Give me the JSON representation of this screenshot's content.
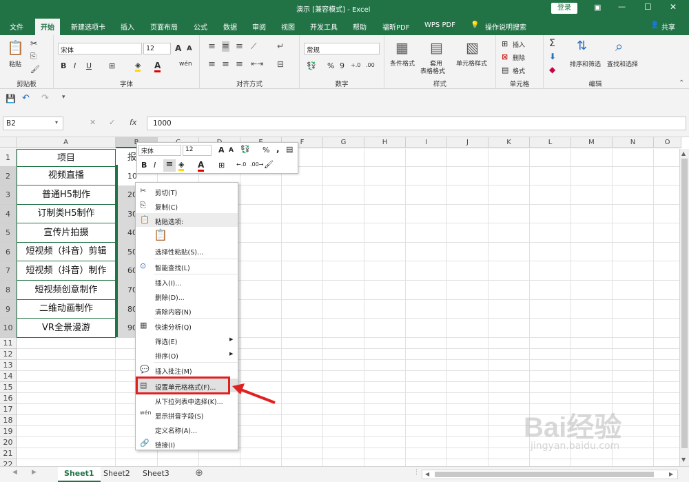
{
  "window": {
    "title": "演示 [兼容模式] - Excel",
    "login": "登录",
    "min": "—",
    "restore": "☐",
    "close": "✕",
    "restore2": "⧉"
  },
  "tabs": [
    "文件",
    "开始",
    "新建选项卡",
    "插入",
    "页面布局",
    "公式",
    "数据",
    "审阅",
    "视图",
    "开发工具",
    "帮助",
    "福昕PDF",
    "WPS PDF",
    "操作说明搜索"
  ],
  "share": "共享",
  "ribbon": {
    "clipboard": {
      "paste": "粘贴",
      "label": "剪贴板"
    },
    "font": {
      "name": "宋体",
      "size": "12",
      "grow": "A",
      "shrink": "A",
      "bold": "B",
      "italic": "I",
      "underline": "U",
      "wen": "wén",
      "fontcolor": "A",
      "label": "字体"
    },
    "align": {
      "label": "对齐方式"
    },
    "number": {
      "format": "常规",
      "percent": "%",
      "comma": "9",
      "inc": "+.0",
      "dec": ".00",
      "label": "数字"
    },
    "styles": {
      "cond": "条件格式",
      "table1": "套用",
      "table2": "表格格式",
      "cell": "单元格样式",
      "label": "样式"
    },
    "cells": {
      "insert": "插入",
      "delete": "删除",
      "format": "格式",
      "label": "单元格"
    },
    "edit": {
      "sigma": "Σ",
      "sort": "排序和筛选",
      "find": "查找和选择",
      "label": "编辑"
    }
  },
  "formula": {
    "namebox": "B2",
    "fx": "fx",
    "cancel": "✕",
    "enter": "✓",
    "value": "1000"
  },
  "columns": [
    "A",
    "B",
    "C",
    "D",
    "E",
    "F",
    "G",
    "H",
    "I",
    "J",
    "K",
    "L",
    "M",
    "N",
    "O"
  ],
  "rows": [
    "1",
    "2",
    "3",
    "4",
    "5",
    "6",
    "7",
    "8",
    "9",
    "10",
    "11",
    "12",
    "13",
    "14",
    "15",
    "16",
    "17",
    "18",
    "19",
    "20",
    "21",
    "22"
  ],
  "colA": [
    "项目",
    "视频直播",
    "普通H5制作",
    "订制类H5制作",
    "宣传片拍摄",
    "短视频（抖音）剪辑",
    "短视频（抖音）制作",
    "短视频创意制作",
    "二维动画制作",
    "VR全景漫游"
  ],
  "colB": [
    "报",
    "1000",
    "20",
    "30",
    "40",
    "50",
    "60",
    "70",
    "80",
    "90"
  ],
  "mini": {
    "font": "宋体",
    "size": "12",
    "grow": "A",
    "shrink": "A",
    "percent": "%",
    "comma": ",",
    "bold": "B",
    "italic": "I",
    "fontcolor": "A"
  },
  "menu": [
    "剪切(T)",
    "复制(C)",
    "粘贴选项:",
    "选择性粘贴(S)...",
    "智能查找(L)",
    "插入(I)...",
    "删除(D)...",
    "清除内容(N)",
    "快速分析(Q)",
    "筛选(E)",
    "排序(O)",
    "插入批注(M)",
    "设置单元格格式(F)...",
    "从下拉列表中选择(K)...",
    "显示拼音字段(S)",
    "定义名称(A)...",
    "链接(I)"
  ],
  "sheets": [
    "Sheet1",
    "Sheet2",
    "Sheet3"
  ],
  "watermark": {
    "brand": "Bai经验",
    "url": "jingyan.baidu.com"
  },
  "colors": {
    "excel_green": "#217346",
    "highlight": "#e02020"
  }
}
